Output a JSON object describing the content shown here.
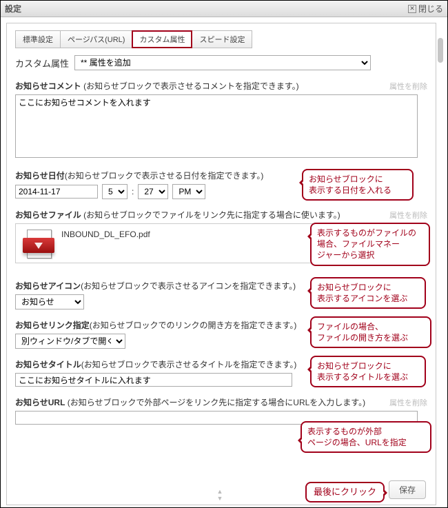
{
  "titlebar": {
    "title": "設定",
    "close_label": "閉じる"
  },
  "tabs": {
    "standard": "標準設定",
    "page_path": "ページパス(URL)",
    "custom_attr": "カスタム属性",
    "speed": "スピード設定"
  },
  "custom_attr": {
    "label": "カスタム属性",
    "select_placeholder": "** 属性を追加"
  },
  "delete_attr_label": "属性を削除",
  "sections": {
    "comment": {
      "title": "お知らせコメント",
      "hint": " (お知らせブロックで表示させるコメントを指定できます。)",
      "value": "ここにお知らせコメントを入れます"
    },
    "date": {
      "title": "お知らせ日付",
      "hint": " (お知らせブロックで表示させる日付を指定できます。)",
      "date_value": "2014-11-17",
      "hour": "5",
      "sep": ":",
      "minute": "27",
      "ampm": "PM"
    },
    "file": {
      "title": "お知らせファイル",
      "hint": " (お知らせブロックでファイルをリンク先に指定する場合に使います。)",
      "file_name": "INBOUND_DL_EFO.pdf"
    },
    "icon": {
      "title": "お知らせアイコン",
      "hint": " (お知らせブロックで表示させるアイコンを指定できます。)",
      "value": "お知らせ"
    },
    "link": {
      "title": "お知らせリンク指定",
      "hint": " (お知らせブロックでのリンクの開き方を指定できます。)",
      "value": "別ウィンドウ/タブで開く"
    },
    "title_sec": {
      "title": "お知らせタイトル",
      "hint": " (お知らせブロックで表示させるタイトルを指定できます。)",
      "value": "ここにお知らせタイトルに入れます"
    },
    "url": {
      "title": "お知らせURL",
      "hint": " (お知らせブロックで外部ページをリンク先に指定する場合にURLを入力します。)",
      "value": ""
    }
  },
  "callouts": {
    "date": "お知らせブロックに\n表示する日付を入れる",
    "file": "表示するものがファイルの\n場合、ファイルマネー\nジャーから選択",
    "icon": "お知らせブロックに\n表示するアイコンを選ぶ",
    "link": "ファイルの場合、\nファイルの開き方を選ぶ",
    "title": "お知らせブロックに\n表示するタイトルを選ぶ",
    "url": "表示するものが外部\nページの場合、URLを指定",
    "save": "最後にクリック"
  },
  "save_label": "保存"
}
